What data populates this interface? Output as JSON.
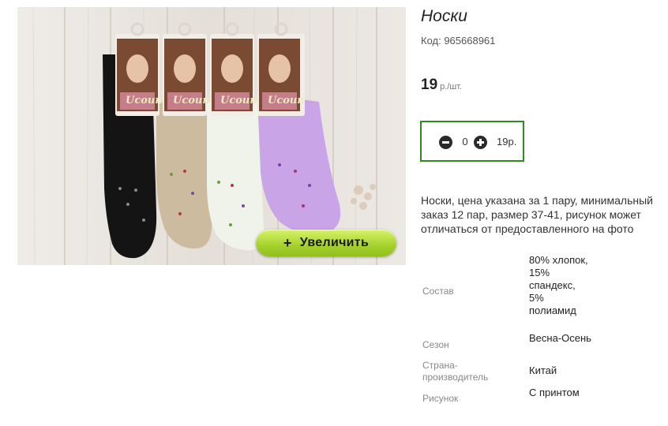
{
  "product": {
    "title": "Носки",
    "code": "Код: 965668961",
    "price_value": "19",
    "price_unit": "р./шт.",
    "zoom_label": "Увеличить",
    "zoom_plus": "+",
    "brand_text": "Ucoun"
  },
  "quantity": {
    "value": "0",
    "sum": "19р."
  },
  "description": "Носки, цена указана за 1 пару, минимальный заказ 12 пар, размер 37-41, рисунок может отличаться от предоставленного на фото",
  "attributes": [
    {
      "label": "Состав",
      "value": "80% хлопок, 15% спандекс, 5% полиамид"
    },
    {
      "label": "Сезон",
      "value": "Весна-Осень"
    },
    {
      "label": "Страна-производитель",
      "value": "Китай"
    },
    {
      "label": "Рисунок",
      "value": "С принтом"
    }
  ],
  "colors": {
    "accent_border": "#2e8b1e",
    "zoom_button": "#a5d12c",
    "sock_colors": [
      "#141414",
      "#cdbb9f",
      "#eff3e9",
      "#c9a4e6"
    ]
  },
  "icons": [
    "minus-circle-icon",
    "plus-circle-icon"
  ]
}
